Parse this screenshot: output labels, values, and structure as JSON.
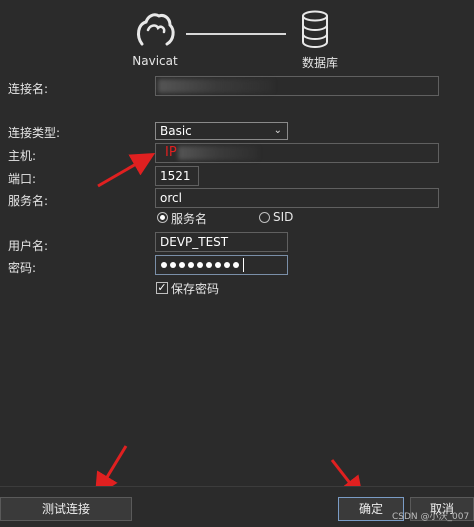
{
  "header": {
    "left_label": "Navicat",
    "right_label": "数据库",
    "left_icon": "navicat-logo-icon",
    "right_icon": "database-icon"
  },
  "form": {
    "connection_name": {
      "label": "连接名:",
      "value": ""
    },
    "connection_type": {
      "label": "连接类型:",
      "value": "Basic"
    },
    "host": {
      "label": "主机:",
      "value": "",
      "annotation": "IP"
    },
    "port": {
      "label": "端口:",
      "value": "1521"
    },
    "service_name": {
      "label": "服务名:",
      "value": "orcl"
    },
    "service_radio": {
      "option_service": "服务名",
      "option_sid": "SID",
      "selected": "服务名"
    },
    "username": {
      "label": "用户名:",
      "value": "DEVP_TEST"
    },
    "password": {
      "label": "密码:",
      "mask_count": 9
    },
    "save_password": {
      "label": "保存密码",
      "checked": true
    }
  },
  "buttons": {
    "test": "测试连接",
    "ok": "确定",
    "cancel": "取消"
  },
  "watermark": "CSDN @小沃_007",
  "colors": {
    "background": "#2b2b2b",
    "annotation": "#e02020",
    "primary_border": "#7a9cc6"
  }
}
